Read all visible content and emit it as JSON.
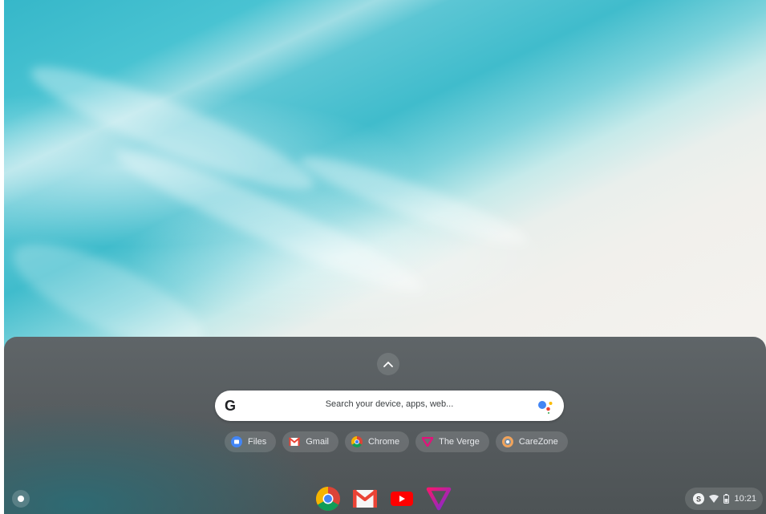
{
  "launcher": {
    "search": {
      "placeholder": "Search your device, apps, web...",
      "google_logo": "G"
    },
    "suggestions": [
      {
        "label": "Files",
        "icon": "files-icon",
        "color": "#4285f4"
      },
      {
        "label": "Gmail",
        "icon": "gmail-icon",
        "color": "#ea4335"
      },
      {
        "label": "Chrome",
        "icon": "chrome-icon",
        "color": "#fbbc04"
      },
      {
        "label": "The Verge",
        "icon": "verge-icon",
        "color": "#e2127a"
      },
      {
        "label": "CareZone",
        "icon": "carezone-icon",
        "color": "#f0a35b"
      }
    ]
  },
  "shelf": {
    "pinned_apps": [
      "chrome-icon",
      "gmail-icon",
      "youtube-icon",
      "verge-icon"
    ],
    "tray": {
      "time": "10:21",
      "account_badge": "S"
    }
  },
  "colors": {
    "launcher_bg": "#575c5f",
    "chip_text": "#e8eaed",
    "accent_blue": "#4285f4",
    "accent_red": "#ea4335",
    "accent_yellow": "#fbbc04",
    "accent_green": "#34a853"
  }
}
